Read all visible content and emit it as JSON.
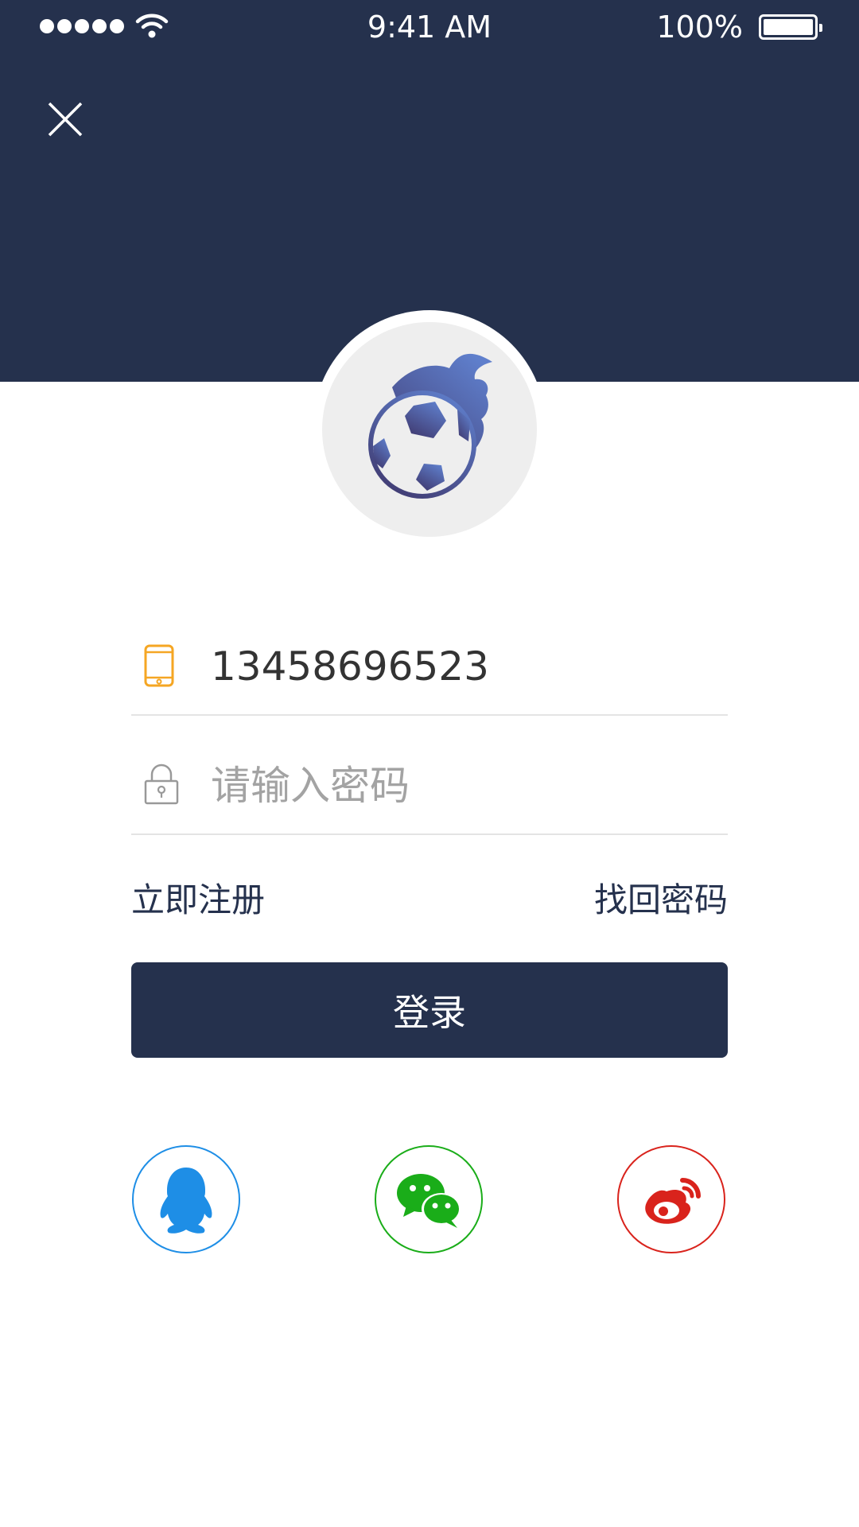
{
  "status_bar": {
    "time": "9:41 AM",
    "battery_percent": "100%",
    "signal_icon": "signal-dots-icon",
    "wifi_icon": "wifi-icon",
    "battery_icon": "battery-icon"
  },
  "header": {
    "close_icon": "close-icon",
    "background_color": "#25314d"
  },
  "logo": {
    "icon": "flaming-soccer-ball-icon"
  },
  "form": {
    "phone": {
      "icon": "phone-icon",
      "value": "13458696523"
    },
    "password": {
      "icon": "lock-icon",
      "placeholder": "请输入密码"
    }
  },
  "links": {
    "register": "立即注册",
    "forgot_password": "找回密码"
  },
  "login_button": {
    "label": "登录"
  },
  "social_login": [
    {
      "name": "qq",
      "icon": "qq-penguin-icon",
      "color": "#1e8ee6"
    },
    {
      "name": "wechat",
      "icon": "wechat-icon",
      "color": "#1aad19"
    },
    {
      "name": "weibo",
      "icon": "weibo-icon",
      "color": "#d9231c"
    }
  ],
  "colors": {
    "primary": "#25314d",
    "accent_phone_icon": "#f5a623",
    "divider": "#e4e4e4"
  }
}
